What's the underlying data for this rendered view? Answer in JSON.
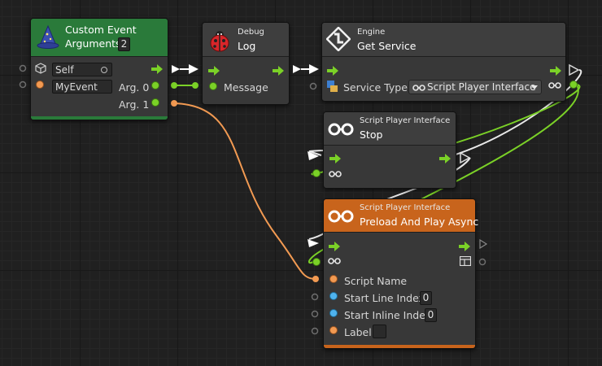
{
  "colors": {
    "flow": "#7bd127",
    "string_port": "#f29a52",
    "number_port": "#4fb3ee",
    "event_header": "#2a7a3a",
    "active_header": "#c8641c"
  },
  "nodes": {
    "custom_event": {
      "title": "Custom Event",
      "arguments_label": "Arguments",
      "arguments_count": "2",
      "target_value": "Self",
      "event_name": "MyEvent",
      "arg0_label": "Arg. 0",
      "arg1_label": "Arg. 1",
      "icon": "wizard-hat-icon"
    },
    "debug_log": {
      "category": "Debug",
      "title": "Log",
      "message_label": "Message",
      "icon": "ladybug-icon"
    },
    "get_service": {
      "category": "Engine",
      "title": "Get Service",
      "service_type_label": "Service Type",
      "service_type_value": "Script Player Interface",
      "icon": "engine-icon"
    },
    "stop": {
      "category": "Script Player Interface",
      "title": "Stop",
      "icon": "interface-link-icon"
    },
    "preload_play": {
      "category": "Script Player Interface",
      "title": "Preload And Play Async",
      "script_name_label": "Script Name",
      "start_line_label": "Start Line Index",
      "start_line_value": "0",
      "start_inline_label": "Start Inline Index",
      "start_inline_value": "0",
      "label_label": "Label",
      "icon": "interface-link-icon"
    }
  }
}
